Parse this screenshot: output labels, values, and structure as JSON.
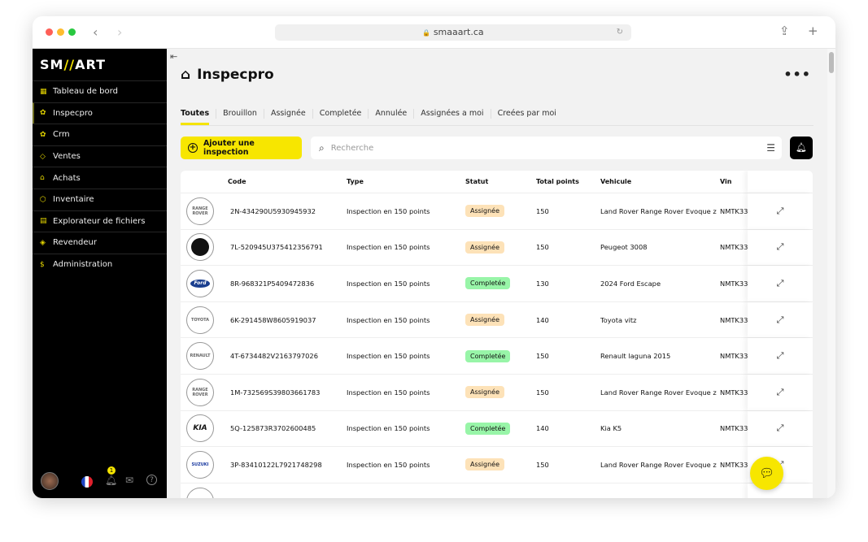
{
  "browser": {
    "url": "smaaart.ca",
    "traffic_lights": [
      "#fe5f57",
      "#febc2e",
      "#28c840"
    ]
  },
  "sidebar": {
    "logo": {
      "prefix": "SM",
      "mark": "//",
      "suffix": "ART"
    },
    "items": [
      {
        "label": "Tableau de bord",
        "icon": "▦"
      },
      {
        "label": "Inspecpro",
        "icon": "✿",
        "active": true
      },
      {
        "label": "Crm",
        "icon": "✿"
      },
      {
        "label": "Ventes",
        "icon": "◇"
      },
      {
        "label": "Achats",
        "icon": "⌂"
      },
      {
        "label": "Inventaire",
        "icon": "⬡"
      },
      {
        "label": "Explorateur de fichiers",
        "icon": "▤"
      },
      {
        "label": "Revendeur",
        "icon": "◈"
      },
      {
        "label": "Administration",
        "icon": "$"
      }
    ],
    "notification_count": "1"
  },
  "header": {
    "title": "Inspecpro"
  },
  "tabs": [
    "Toutes",
    "Brouillon",
    "Assignée",
    "Completée",
    "Annulée",
    "Assignées a moi",
    "Creées par moi"
  ],
  "active_tab": 0,
  "toolbar": {
    "add_label": "Ajouter une inspection",
    "search_placeholder": "Recherche"
  },
  "colors": {
    "accent": "#f7e600",
    "assigned_bg": "#fde2b8",
    "completed_bg": "#98f5a8"
  },
  "table": {
    "columns": [
      "",
      "Code",
      "Type",
      "Statut",
      "Total points",
      "Vehicule",
      "Vin"
    ],
    "rows": [
      {
        "logo": "RANGE ROVER",
        "code": "2N-434290U5930945932",
        "type": "Inspection en 150 points",
        "status": "Assignée",
        "points": "150",
        "vehicle": "Land Rover Range Rover Evoque z",
        "vin": "NMTK33"
      },
      {
        "logo": "PEUGEOT",
        "code": "7L-520945U375412356791",
        "type": "Inspection en 150 points",
        "status": "Assignée",
        "points": "150",
        "vehicle": "Peugeot 3008",
        "vin": "NMTK33"
      },
      {
        "logo": "Ford",
        "code": "8R-968321P5409472836",
        "type": "Inspection en 150 points",
        "status": "Completée",
        "points": "130",
        "vehicle": "2024 Ford Escape",
        "vin": "NMTK33"
      },
      {
        "logo": "TOYOTA",
        "code": "6K-291458W8605919037",
        "type": "Inspection en 150 points",
        "status": "Assignée",
        "points": "140",
        "vehicle": "Toyota vitz",
        "vin": "NMTK33"
      },
      {
        "logo": "RENAULT",
        "code": "4T-6734482V2163797026",
        "type": "Inspection en 150 points",
        "status": "Completée",
        "points": "150",
        "vehicle": "Renault laguna 2015",
        "vin": "NMTK33"
      },
      {
        "logo": "RANGE ROVER",
        "code": "1M-732569S39803661783",
        "type": "Inspection en 150 points",
        "status": "Assignée",
        "points": "150",
        "vehicle": "Land Rover Range Rover Evoque z",
        "vin": "NMTK33"
      },
      {
        "logo": "KIA",
        "code": "5Q-125873R3702600485",
        "type": "Inspection en 150 points",
        "status": "Completée",
        "points": "140",
        "vehicle": "Kia K5",
        "vin": "NMTK33"
      },
      {
        "logo": "SUZUKI",
        "code": "3P-83410122L7921748298",
        "type": "Inspection en 150 points",
        "status": "Assignée",
        "points": "150",
        "vehicle": "Land Rover Range Rover Evoque z",
        "vin": "NMTK33"
      }
    ]
  }
}
